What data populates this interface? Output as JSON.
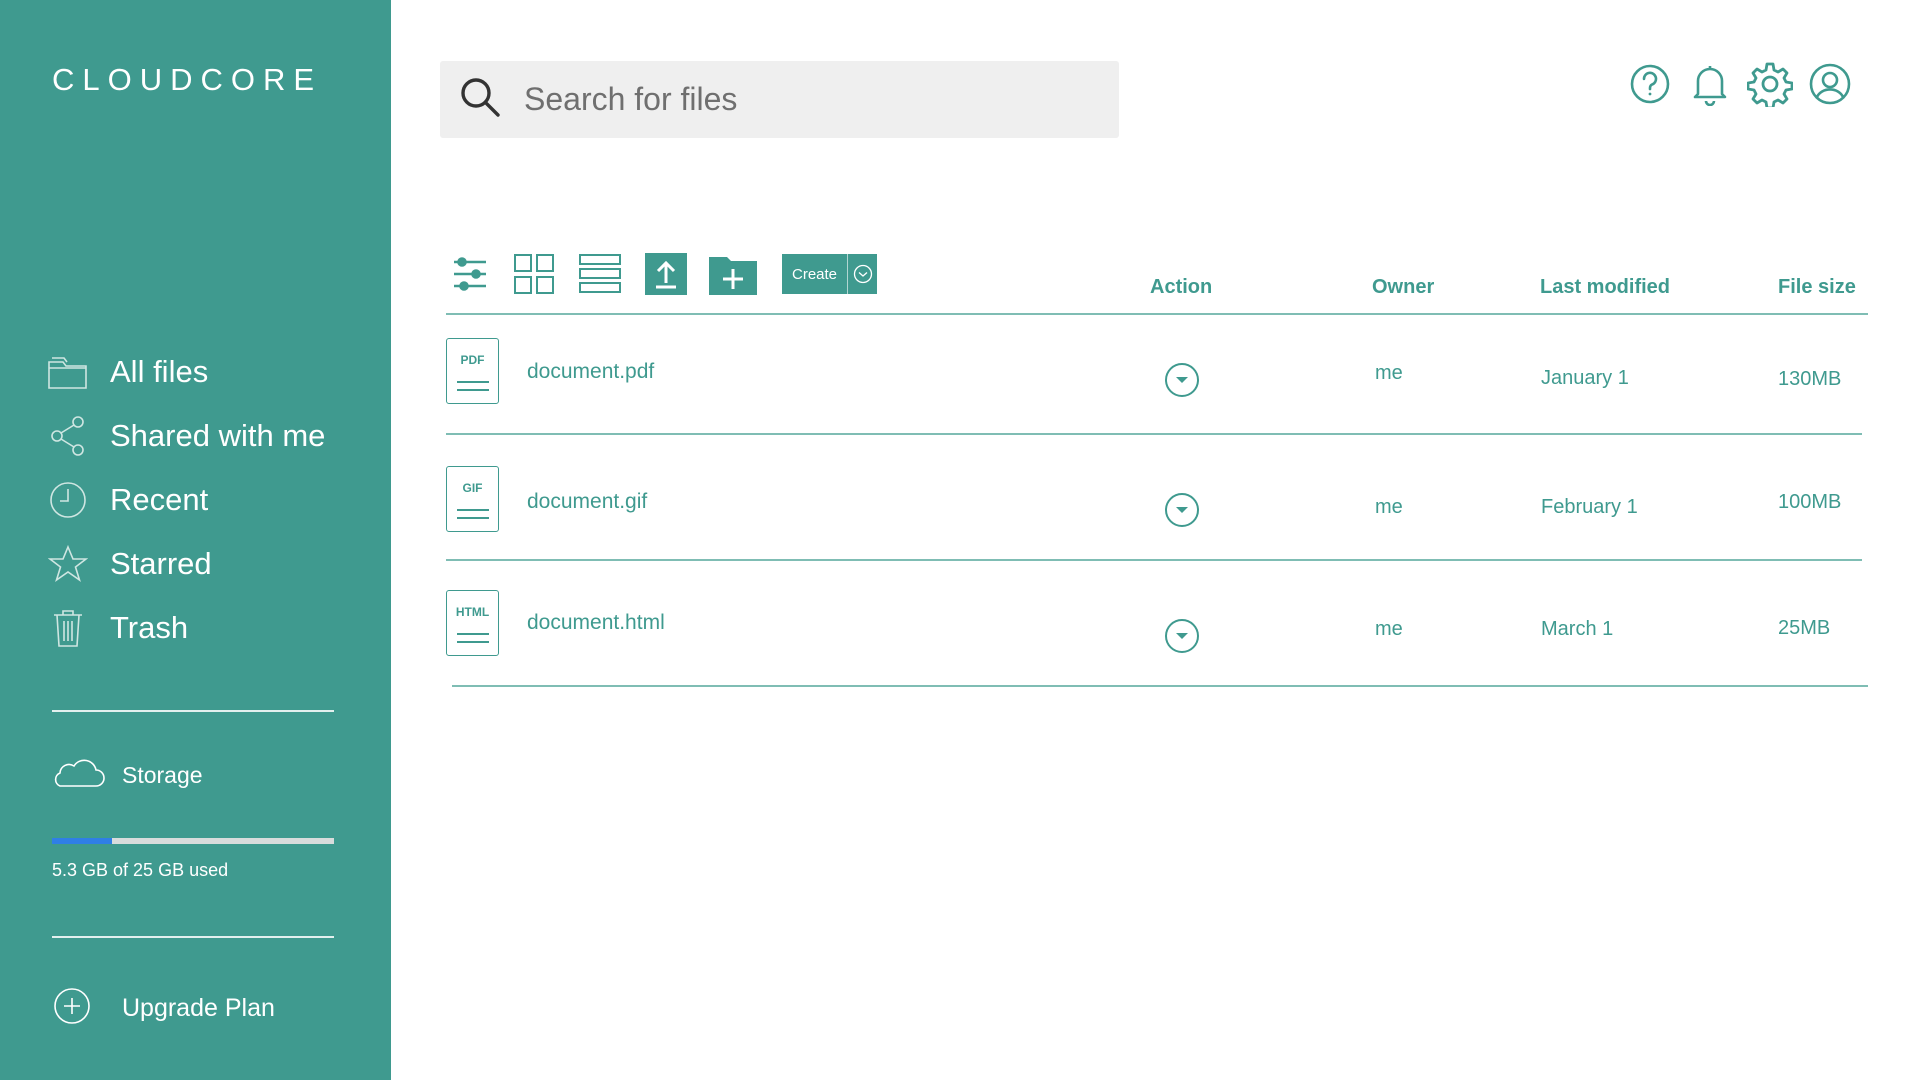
{
  "app": {
    "brand": "CLOUDCORE"
  },
  "sidebar": {
    "items": [
      {
        "label": "All files",
        "icon": "folder-icon"
      },
      {
        "label": "Shared with me",
        "icon": "share-icon"
      },
      {
        "label": "Recent",
        "icon": "clock-icon"
      },
      {
        "label": "Starred",
        "icon": "star-icon"
      },
      {
        "label": "Trash",
        "icon": "trash-icon"
      }
    ],
    "storage": {
      "label": "Storage",
      "icon": "cloud-icon",
      "used_text": "5.3 GB of 25 GB used",
      "used_gb": 5.3,
      "total_gb": 25
    },
    "upgrade_label": "Upgrade Plan"
  },
  "header": {
    "search_placeholder": "Search for files",
    "icons": [
      "help-icon",
      "bell-icon",
      "gear-icon",
      "user-icon"
    ]
  },
  "toolbar": {
    "create_label": "Create",
    "icons": [
      "sliders-icon",
      "grid-view-icon",
      "list-view-icon",
      "upload-icon",
      "new-folder-icon"
    ]
  },
  "table": {
    "columns": {
      "action": "Action",
      "owner": "Owner",
      "modified": "Last modified",
      "size": "File size"
    },
    "rows": [
      {
        "ext": "PDF",
        "name": "document.pdf",
        "owner": "me",
        "modified": "January 1",
        "size": "130MB"
      },
      {
        "ext": "GIF",
        "name": "document.gif",
        "owner": "me",
        "modified": "February 1",
        "size": "100MB"
      },
      {
        "ext": "HTML",
        "name": "document.html",
        "owner": "me",
        "modified": "March 1",
        "size": "25MB"
      }
    ]
  },
  "colors": {
    "accent": "#3f9a8f",
    "progress": "#2f7fe6",
    "search_bg": "#efefef"
  }
}
